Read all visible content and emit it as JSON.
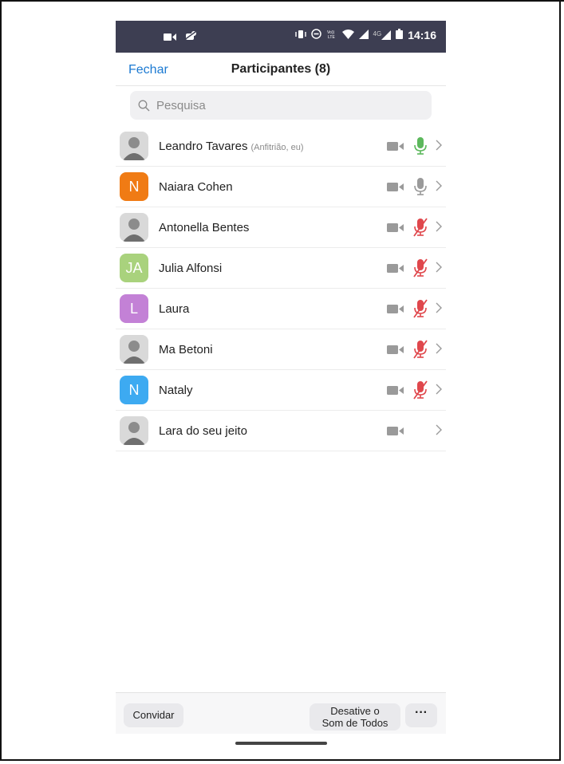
{
  "status_bar": {
    "time": "14:16",
    "network": "4G",
    "left_icons": [
      "video-recorder-icon",
      "settings-bug-icon"
    ],
    "right_icons": [
      "vibrate-icon",
      "do-not-disturb-icon",
      "volte-icon",
      "wifi-icon",
      "signal-icon",
      "signal-4g-icon",
      "battery-icon"
    ],
    "background": "#3d3e52"
  },
  "nav": {
    "close_label": "Fechar",
    "title": "Participantes (8)",
    "accent": "#1c7ad2"
  },
  "search": {
    "placeholder": "Pesquisa"
  },
  "participants": [
    {
      "name": "Leandro Tavares",
      "tag": "(Anfitrião, eu)",
      "avatar_type": "photo",
      "initial": "",
      "mic": "on"
    },
    {
      "name": "Naiara Cohen",
      "tag": "",
      "avatar_type": "initial",
      "initial": "N",
      "avatar_color": "#f07b14",
      "mic": "idle"
    },
    {
      "name": "Antonella Bentes",
      "tag": "",
      "avatar_type": "photo",
      "initial": "",
      "mic": "muted"
    },
    {
      "name": "Julia Alfonsi",
      "tag": "",
      "avatar_type": "initial",
      "initial": "JA",
      "avatar_color": "#a9d27d",
      "mic": "muted"
    },
    {
      "name": "Laura",
      "tag": "",
      "avatar_type": "initial",
      "initial": "L",
      "avatar_color": "#c381d6",
      "mic": "muted"
    },
    {
      "name": "Ma Betoni",
      "tag": "",
      "avatar_type": "photo",
      "initial": "",
      "mic": "muted"
    },
    {
      "name": "Nataly",
      "tag": "",
      "avatar_type": "initial",
      "initial": "N",
      "avatar_color": "#3daaf1",
      "mic": "muted"
    },
    {
      "name": "Lara do seu jeito",
      "tag": "",
      "avatar_type": "photo",
      "initial": "",
      "mic": "none"
    }
  ],
  "colors": {
    "mic_on": "#5cb85c",
    "mic_idle": "#9a9a9a",
    "mic_muted": "#e0474c",
    "camera_off": "#9a9a9a"
  },
  "bottom_bar": {
    "invite_label": "Convidar",
    "mute_all_line1": "Desative o",
    "mute_all_line2": "Som de Todos",
    "more_label": "···"
  }
}
